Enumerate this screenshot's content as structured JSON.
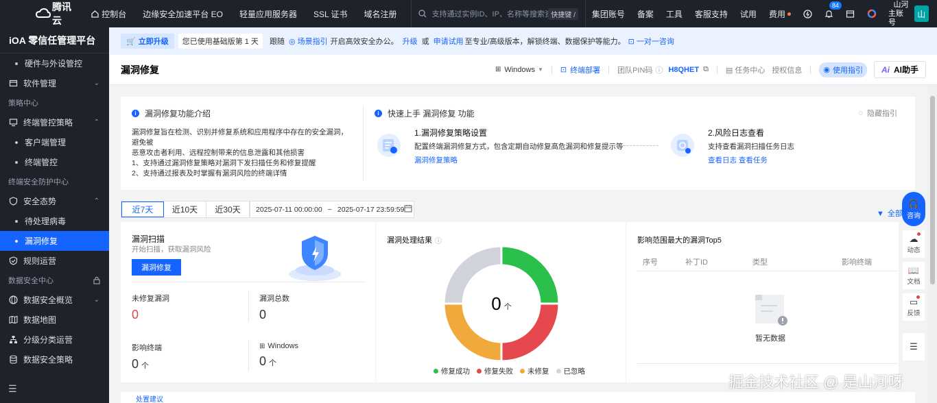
{
  "topbar": {
    "brand": "腾讯云",
    "nav": [
      "控制台",
      "边缘安全加速平台 EO",
      "轻量应用服务器",
      "SSL 证书",
      "域名注册"
    ],
    "search_placeholder": "支持通过实例ID、IP、名称等搜索资源",
    "shortcut": "快捷键 /",
    "right": [
      "集团账号",
      "备案",
      "工具",
      "客服支持",
      "试用",
      "费用"
    ],
    "notif_count": "84",
    "account_line1": "山河",
    "account_line2": "主账号",
    "avatar_text": "山"
  },
  "sidebar": {
    "title": "iOA 零信任管理平台",
    "items": [
      {
        "label": "硬件与外设管控",
        "type": "sub"
      },
      {
        "label": "软件管理",
        "type": "item",
        "icon": "box-icon",
        "chevron": "⌄"
      },
      {
        "label": "策略中心",
        "type": "group"
      },
      {
        "label": "终端管控策略",
        "type": "item",
        "icon": "monitor-icon",
        "chevron": "⌃"
      },
      {
        "label": "客户端管理",
        "type": "sub"
      },
      {
        "label": "终端管控",
        "type": "sub"
      },
      {
        "label": "终端安全防护中心",
        "type": "group"
      },
      {
        "label": "安全态势",
        "type": "item",
        "icon": "shield-icon",
        "chevron": "⌃"
      },
      {
        "label": "待处理病毒",
        "type": "sub"
      },
      {
        "label": "漏洞修复",
        "type": "sub",
        "active": true
      },
      {
        "label": "规则运营",
        "type": "item",
        "icon": "shield-check-icon"
      },
      {
        "label": "数据安全中心",
        "type": "group",
        "lock": true
      },
      {
        "label": "数据安全概览",
        "type": "item",
        "icon": "globe-icon",
        "chevron": "⌄"
      },
      {
        "label": "数据地图",
        "type": "item",
        "icon": "map-icon"
      },
      {
        "label": "分级分类运营",
        "type": "item",
        "icon": "tree-icon"
      },
      {
        "label": "数据安全策略",
        "type": "item",
        "icon": "database-icon"
      }
    ]
  },
  "notice": {
    "upgrade": "立即升级",
    "version": "您已使用基础版第 1 天",
    "t1": "跟随",
    "guide": "场景指引",
    "t2": "开启高效安全办公。",
    "upgrade2": "升级",
    "or": "或",
    "trial": "申请试用",
    "t3": "至专业/高级版本，解锁终端、数据保护等能力。",
    "consult": "一对一咨询"
  },
  "page": {
    "title": "漏洞修复",
    "os": "Windows",
    "deploy": "终端部署",
    "pin_label": "团队PIN码",
    "pin": "H8QHET",
    "task_center": "任务中心",
    "license": "授权信息",
    "guide": "使用指引",
    "ai": "AI助手"
  },
  "intro": {
    "title": "漏洞修复功能介绍",
    "desc": [
      "漏洞修复旨在检测、识别并修复系统和应用程序中存在的安全漏洞，避免被",
      "恶意攻击者利用、远程控制带来的信息泄露和其他损害",
      "1、支持通过漏洞修复策略对漏洞下发扫描任务和修复提醒",
      "2、支持通过报表及时掌握有漏洞风险的终端详情"
    ],
    "quick_title": "快速上手 漏洞修复 功能",
    "hide": "隐藏指引",
    "step1_title": "1.漏洞修复策略设置",
    "step1_desc": "配置终端漏洞修复方式，包含定期自动修复高危漏洞和修复提示等",
    "step1_link": "漏洞修复策略",
    "step2_title": "2.风险日志查看",
    "step2_desc": "支持查看漏洞扫描任务日志",
    "step2_link1": "查看日志",
    "step2_link2": "查看任务"
  },
  "filters": {
    "ranges": [
      "近7天",
      "近10天",
      "近30天"
    ],
    "start": "2025-07-11 00:00:00",
    "sep": "~",
    "end": "2025-07-17 23:59:59",
    "right": "全部"
  },
  "scan": {
    "title": "漏洞扫描",
    "subtitle": "开始扫描，获取漏洞风险",
    "button": "漏洞修复",
    "unfixed_label": "未修复漏洞",
    "unfixed": "0",
    "total_label": "漏洞总数",
    "total": "0",
    "terminals_label": "影响终端",
    "terminals": "0",
    "unit": "个",
    "windows_label": "Windows",
    "windows": "0"
  },
  "result": {
    "title": "漏洞处理结果",
    "center": "0",
    "unit": "个"
  },
  "chart_data": {
    "type": "pie",
    "title": "漏洞处理结果",
    "categories": [
      "修复成功",
      "修复失败",
      "未修复",
      "已忽略"
    ],
    "values": [
      25,
      25,
      25,
      25
    ],
    "colors": [
      "#2bbf4b",
      "#e5484d",
      "#f2a93b",
      "#d0d3d9"
    ]
  },
  "top5": {
    "title": "影响范围最大的漏洞Top5",
    "columns": [
      "序号",
      "补丁ID",
      "类型",
      "影响终端"
    ],
    "empty": "暂无数据"
  },
  "floatbar": {
    "consult": "咨询",
    "items": [
      "动态",
      "文档",
      "反馈"
    ]
  },
  "bottom": {
    "text": "处置建议"
  },
  "watermark": "掘金技术社区 @ 是山河呀"
}
